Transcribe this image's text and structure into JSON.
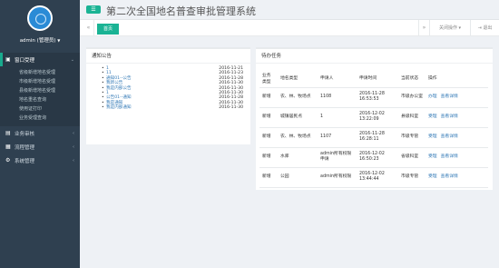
{
  "app": {
    "title": "第二次全国地名普查审批管理系统",
    "user": "admin (管理员)"
  },
  "sidebar": {
    "groups": [
      {
        "label": "窗口受理",
        "icon": "window-icon",
        "active": true,
        "items": [
          "省级新增地名受理",
          "市级新增地名受理",
          "县级新增地名受理",
          "地名重名查询",
          "使用证打印",
          "业务受理查询"
        ]
      },
      {
        "label": "业务审核",
        "icon": "audit-icon"
      },
      {
        "label": "流程管理",
        "icon": "flow-icon"
      },
      {
        "label": "系统管理",
        "icon": "settings-icon"
      }
    ]
  },
  "tabbar": {
    "back": "«",
    "home": "首页",
    "forward": "»",
    "close_ops": "关闭操作",
    "logout": "退出"
  },
  "notice": {
    "title": "通知公告",
    "items": [
      {
        "title": "1",
        "date": "2016-11-21"
      },
      {
        "title": "11",
        "date": "2016-11-23"
      },
      {
        "title": "通知01--公告",
        "date": "2016-11-28"
      },
      {
        "title": "我新公告",
        "date": "2016-11-30"
      },
      {
        "title": "我是内部公告",
        "date": "2016-11-30"
      },
      {
        "title": "1",
        "date": "2016-11-30"
      },
      {
        "title": "公告01--通知",
        "date": "2016-11-28"
      },
      {
        "title": "我是通知",
        "date": "2016-11-30"
      },
      {
        "title": "我是内部通知",
        "date": "2016-11-30"
      }
    ]
  },
  "tasks": {
    "title": "待办任务",
    "columns": [
      "业务类型",
      "地名类型",
      "申请人",
      "申请时间",
      "当前状态",
      "操作"
    ],
    "rows": [
      {
        "type": "新增",
        "dtype": "农、林、牧场点",
        "applicant": "1108",
        "time": "2016-11-28 16:53:53",
        "status": "市级办公室",
        "ops": [
          "办理",
          "查看详情"
        ]
      },
      {
        "type": "新增",
        "dtype": "城镇居民点",
        "applicant": "1",
        "time": "2016-12-02 13:22:09",
        "status": "县级科室",
        "ops": [
          "受理",
          "查看详情"
        ]
      },
      {
        "type": "新增",
        "dtype": "农、林、牧场点",
        "applicant": "1107",
        "time": "2016-11-28 16:28:11",
        "status": "市级专管",
        "ops": [
          "受理",
          "查看详情"
        ]
      },
      {
        "type": "新增",
        "dtype": "水库",
        "applicant": "admin所有权限申请",
        "time": "2016-12-02 16:50:23",
        "status": "省级科室",
        "ops": [
          "受理",
          "查看详情"
        ]
      },
      {
        "type": "新增",
        "dtype": "公园",
        "applicant": "admin所有权限",
        "time": "2016-12-02 13:44:44",
        "status": "市级专管",
        "ops": [
          "受理",
          "查看详情"
        ]
      }
    ]
  }
}
